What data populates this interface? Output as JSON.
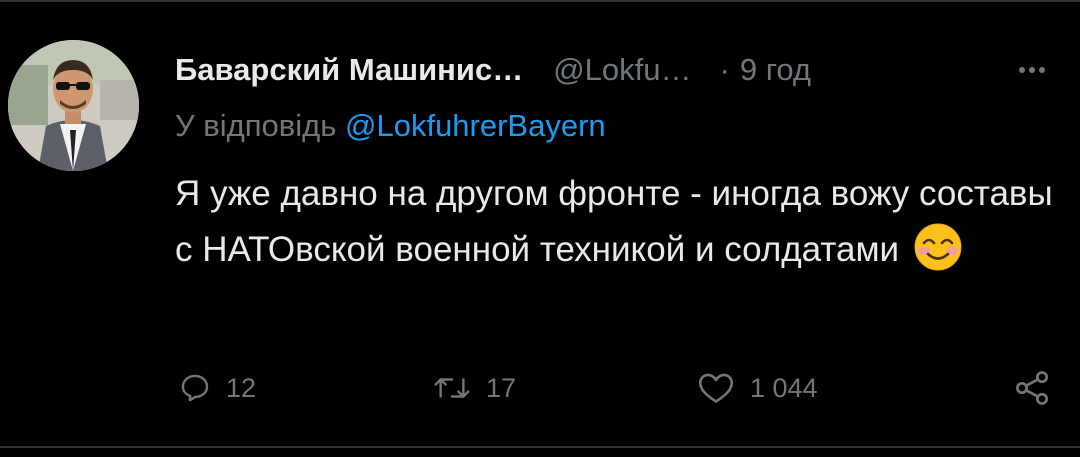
{
  "tweet": {
    "author": {
      "display_name": "Баварский Машинис…",
      "handle": "@Lokfu…",
      "avatar_icon": "user-avatar-photo"
    },
    "separator": "·",
    "time": "9 год",
    "reply_prefix": "У відповідь ",
    "reply_handle": "@LokfuhrerBayern",
    "text": "Я уже давно на другом фронте - иногда вожу составы с НАТОвской военной техникой и солдатами",
    "emoji_icon": "smiling-face-with-smiling-eyes-emoji"
  },
  "actions": {
    "replies": {
      "icon": "reply-icon",
      "count": "12"
    },
    "retweets": {
      "icon": "retweet-icon",
      "count": "17"
    },
    "likes": {
      "icon": "heart-icon",
      "count": "1 044"
    },
    "share": {
      "icon": "share-icon"
    }
  },
  "colors": {
    "background": "#000000",
    "primary_text": "#e7e9ea",
    "secondary_text": "#71767b",
    "link": "#1d9bf0",
    "divider": "#2f3336"
  }
}
